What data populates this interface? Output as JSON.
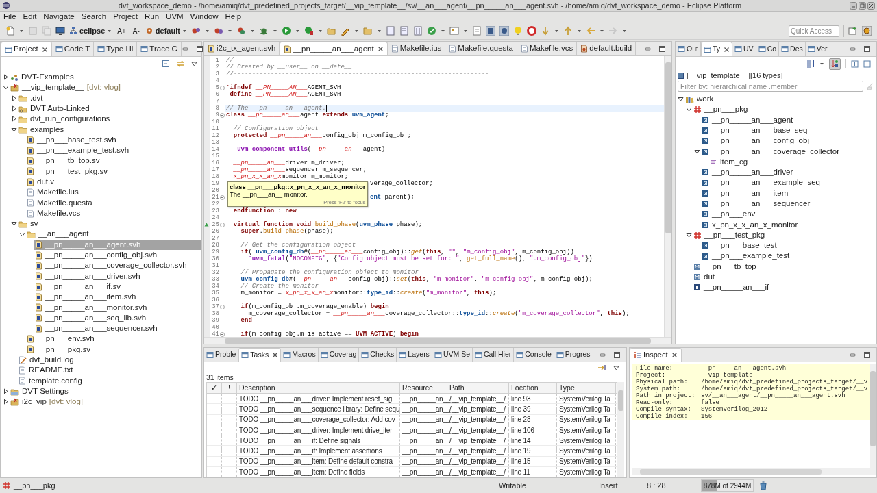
{
  "window": {
    "title": "dvt_workspace_demo - /home/amiq/dvt_predefined_projects_target/__vip_template__/sv/__an___agent/__pn_____an___agent.svh - /home/amiq/dvt_workspace_demo - Eclipse Platform"
  },
  "menu": [
    "File",
    "Edit",
    "Navigate",
    "Search",
    "Project",
    "Run",
    "UVM",
    "Window",
    "Help"
  ],
  "toolbar": {
    "perspective": "eclipse",
    "font_increase": "A+",
    "font_decrease": "A-",
    "build_config": "default",
    "quick_access_placeholder": "Quick Access"
  },
  "project_view": {
    "tabs": [
      {
        "label": "Project",
        "selected": true
      },
      {
        "label": "Code T",
        "selected": false
      },
      {
        "label": "Type Hi",
        "selected": false
      },
      {
        "label": "Trace C",
        "selected": false
      }
    ],
    "tree": [
      {
        "label": "DVT-Examples",
        "kind": "examples",
        "expanded": false,
        "selected": false
      },
      {
        "label": "__vip_template__",
        "tag": "[dvt: vlog]",
        "kind": "project",
        "expanded": true,
        "selected": false,
        "children": [
          {
            "label": ".dvt",
            "kind": "folder",
            "expanded": false,
            "selected": false
          },
          {
            "label": "DVT Auto-Linked",
            "kind": "linked-folder",
            "expanded": false,
            "selected": false
          },
          {
            "label": "dvt_run_configurations",
            "kind": "folder",
            "expanded": false,
            "selected": false
          },
          {
            "label": "examples",
            "kind": "folder",
            "expanded": true,
            "selected": false,
            "children": [
              {
                "label": "__pn___base_test.svh",
                "kind": "sv-file",
                "selected": false
              },
              {
                "label": "__pn___example_test.svh",
                "kind": "sv-file",
                "selected": false
              },
              {
                "label": "__pn___tb_top.sv",
                "kind": "sv-file",
                "selected": false
              },
              {
                "label": "__pn___test_pkg.sv",
                "kind": "sv-file",
                "selected": false
              },
              {
                "label": "dut.v",
                "kind": "sv-file",
                "selected": false
              },
              {
                "label": "Makefile.ius",
                "kind": "text-file",
                "selected": false
              },
              {
                "label": "Makefile.questa",
                "kind": "text-file",
                "selected": false
              },
              {
                "label": "Makefile.vcs",
                "kind": "text-file",
                "selected": false
              }
            ]
          },
          {
            "label": "sv",
            "kind": "folder",
            "expanded": true,
            "selected": false,
            "children": [
              {
                "label": "__an___agent",
                "kind": "folder",
                "expanded": true,
                "selected": false,
                "children": [
                  {
                    "label": "__pn_____an___agent.svh",
                    "kind": "sv-file",
                    "selected": true
                  },
                  {
                    "label": "__pn_____an___config_obj.svh",
                    "kind": "sv-file",
                    "selected": false
                  },
                  {
                    "label": "__pn_____an___coverage_collector.svh",
                    "kind": "sv-file",
                    "selected": false
                  },
                  {
                    "label": "__pn_____an___driver.svh",
                    "kind": "sv-file",
                    "selected": false
                  },
                  {
                    "label": "__pn_____an___if.sv",
                    "kind": "sv-file",
                    "selected": false
                  },
                  {
                    "label": "__pn_____an___item.svh",
                    "kind": "sv-file",
                    "selected": false
                  },
                  {
                    "label": "__pn_____an___monitor.svh",
                    "kind": "sv-file",
                    "selected": false
                  },
                  {
                    "label": "__pn_____an___seq_lib.svh",
                    "kind": "sv-file",
                    "selected": false
                  },
                  {
                    "label": "__pn_____an___sequencer.svh",
                    "kind": "sv-file",
                    "selected": false
                  }
                ]
              },
              {
                "label": "__pn___env.svh",
                "kind": "sv-file",
                "selected": false
              },
              {
                "label": "__pn___pkg.sv",
                "kind": "sv-file",
                "selected": false
              }
            ]
          },
          {
            "label": "dvt_build.log",
            "kind": "log-file",
            "selected": false
          },
          {
            "label": "README.txt",
            "kind": "text-file",
            "selected": false
          },
          {
            "label": "template.config",
            "kind": "text-file",
            "selected": false
          }
        ]
      },
      {
        "label": "DVT-Settings",
        "kind": "settings-project",
        "expanded": false,
        "selected": false
      },
      {
        "label": "i2c_vip",
        "tag": "[dvt: vlog]",
        "kind": "project",
        "expanded": false,
        "selected": false
      }
    ]
  },
  "editor": {
    "tabs": [
      {
        "label": "i2c_tx_agent.svh",
        "kind": "sv-file",
        "selected": false
      },
      {
        "label": "__pn_____an___agent",
        "kind": "sv-file",
        "selected": true
      },
      {
        "label": "Makefile.ius",
        "kind": "text-file",
        "selected": false
      },
      {
        "label": "Makefile.questa",
        "kind": "text-file",
        "selected": false
      },
      {
        "label": "Makefile.vcs",
        "kind": "text-file",
        "selected": false
      },
      {
        "label": "default.build",
        "kind": "build-file",
        "selected": false
      }
    ],
    "lines": [
      {
        "number": "1",
        "current": false,
        "segments": [
          {
            "kind": "c",
            "text": "//---------------------------------------------------------------------"
          }
        ]
      },
      {
        "number": "2",
        "current": false,
        "segments": [
          {
            "kind": "c",
            "text": "// Created by __user__ on __date__"
          }
        ]
      },
      {
        "number": "3",
        "current": false,
        "segments": [
          {
            "kind": "c",
            "text": "//---------------------------------------------------------------------"
          }
        ]
      },
      {
        "number": "4",
        "current": false
      },
      {
        "number": "5",
        "current": false,
        "fold": true,
        "segments": [
          {
            "kind": "k",
            "text": "`ifndef "
          },
          {
            "kind": "p",
            "text": "__PN_____AN___"
          },
          {
            "kind": "x",
            "text": "AGENT_SVH"
          }
        ]
      },
      {
        "number": "6",
        "current": false,
        "segments": [
          {
            "kind": "k",
            "text": "`define "
          },
          {
            "kind": "p",
            "text": "__PN_____AN___"
          },
          {
            "kind": "x",
            "text": "AGENT_SVH"
          }
        ]
      },
      {
        "number": "7",
        "current": false
      },
      {
        "number": "8",
        "current": true,
        "segments": [
          {
            "kind": "c",
            "text": "// The __pn__ __an__ agent."
          }
        ]
      },
      {
        "number": "9",
        "current": false,
        "fold": true,
        "segments": [
          {
            "kind": "k",
            "text": "class "
          },
          {
            "kind": "p",
            "text": "__pn_____an___"
          },
          {
            "kind": "x",
            "text": "agent "
          },
          {
            "kind": "k",
            "text": "extends "
          },
          {
            "kind": "t",
            "text": "uvm_agent"
          },
          {
            "kind": "x",
            "text": ";"
          }
        ]
      },
      {
        "number": "10",
        "current": false
      },
      {
        "number": "11",
        "current": false,
        "segments": [
          {
            "kind": "c",
            "text": "  // Configuration object"
          }
        ]
      },
      {
        "number": "12",
        "current": false,
        "segments": [
          {
            "kind": "k",
            "text": "  protected "
          },
          {
            "kind": "p",
            "text": "__pn_____an___"
          },
          {
            "kind": "x",
            "text": "config_obj m_config_obj;"
          }
        ]
      },
      {
        "number": "13",
        "current": false
      },
      {
        "number": "14",
        "current": false,
        "segments": [
          {
            "kind": "m",
            "text": "  `uvm_component_utils"
          },
          {
            "kind": "x",
            "text": "("
          },
          {
            "kind": "p",
            "text": "__pn_____an___"
          },
          {
            "kind": "x",
            "text": "agent)"
          }
        ]
      },
      {
        "number": "15",
        "current": false
      },
      {
        "number": "16",
        "current": false,
        "segments": [
          {
            "kind": "p",
            "text": "  __pn_____an___"
          },
          {
            "kind": "x",
            "text": "driver m_driver;"
          }
        ]
      },
      {
        "number": "17",
        "current": false,
        "segments": [
          {
            "kind": "p",
            "text": "  __pn_____an___"
          },
          {
            "kind": "x",
            "text": "sequencer m_sequencer;"
          }
        ]
      },
      {
        "number": "18",
        "current": false,
        "segments": [
          {
            "kind": "p",
            "text": "  x_pn_x_x_an_x"
          },
          {
            "kind": "x",
            "text": "monitor m_monitor;"
          }
        ]
      },
      {
        "number": "19",
        "current": false,
        "covered": true,
        "segments": [
          {
            "kind": "x",
            "text": "verage_collector;"
          }
        ]
      },
      {
        "number": "20",
        "current": false
      },
      {
        "number": "21",
        "current": false,
        "fold": true,
        "covered": true,
        "segments": [
          {
            "kind": "t",
            "text": "ent"
          },
          {
            "kind": "x",
            "text": " parent);"
          }
        ]
      },
      {
        "number": "22",
        "current": false
      },
      {
        "number": "23",
        "current": false,
        "segments": [
          {
            "kind": "k",
            "text": "  endfunction"
          },
          {
            "kind": "x",
            "text": " : "
          },
          {
            "kind": "k",
            "text": "new"
          }
        ]
      },
      {
        "number": "24",
        "current": false
      },
      {
        "number": "25",
        "current": false,
        "fold": true,
        "override": true,
        "segments": [
          {
            "kind": "k",
            "text": "  virtual function void "
          },
          {
            "kind": "f",
            "text": "build_phase"
          },
          {
            "kind": "x",
            "text": "("
          },
          {
            "kind": "t",
            "text": "uvm_phase"
          },
          {
            "kind": "x",
            "text": " phase);"
          }
        ]
      },
      {
        "number": "26",
        "current": false,
        "segments": [
          {
            "kind": "k",
            "text": "    super"
          },
          {
            "kind": "x",
            "text": "."
          },
          {
            "kind": "f",
            "text": "build_phase"
          },
          {
            "kind": "x",
            "text": "(phase);"
          }
        ]
      },
      {
        "number": "27",
        "current": false
      },
      {
        "number": "28",
        "current": false,
        "segments": [
          {
            "kind": "c",
            "text": "    // Get the configuration object"
          }
        ]
      },
      {
        "number": "29",
        "current": false,
        "segments": [
          {
            "kind": "k",
            "text": "    if"
          },
          {
            "kind": "x",
            "text": "(!"
          },
          {
            "kind": "t",
            "text": "uvm_config_db"
          },
          {
            "kind": "x",
            "text": "#("
          },
          {
            "kind": "p",
            "text": "__pn_____an___"
          },
          {
            "kind": "x",
            "text": "config_obj)::"
          },
          {
            "kind": "fi",
            "text": "get"
          },
          {
            "kind": "x",
            "text": "("
          },
          {
            "kind": "k",
            "text": "this"
          },
          {
            "kind": "x",
            "text": ", "
          },
          {
            "kind": "s",
            "text": "\"\""
          },
          {
            "kind": "x",
            "text": ", "
          },
          {
            "kind": "s",
            "text": "\"m_config_obj\""
          },
          {
            "kind": "x",
            "text": ", m_config_obj))"
          }
        ]
      },
      {
        "number": "30",
        "current": false,
        "segments": [
          {
            "kind": "m",
            "text": "      `uvm_fatal"
          },
          {
            "kind": "x",
            "text": "("
          },
          {
            "kind": "s",
            "text": "\"NOCONFIG\""
          },
          {
            "kind": "x",
            "text": ", {"
          },
          {
            "kind": "s",
            "text": "\"Config object must be set for: \""
          },
          {
            "kind": "x",
            "text": ", "
          },
          {
            "kind": "f",
            "text": "get_full_name"
          },
          {
            "kind": "x",
            "text": "(), "
          },
          {
            "kind": "s",
            "text": "\".m_config_obj\""
          },
          {
            "kind": "x",
            "text": "})"
          }
        ]
      },
      {
        "number": "31",
        "current": false
      },
      {
        "number": "32",
        "current": false,
        "segments": [
          {
            "kind": "c",
            "text": "    // Propagate the configuration object to monitor"
          }
        ]
      },
      {
        "number": "33",
        "current": false,
        "segments": [
          {
            "kind": "t",
            "text": "    uvm_config_db"
          },
          {
            "kind": "x",
            "text": "#("
          },
          {
            "kind": "p",
            "text": "__pn_____an___"
          },
          {
            "kind": "x",
            "text": "config_obj)::"
          },
          {
            "kind": "fi",
            "text": "set"
          },
          {
            "kind": "x",
            "text": "("
          },
          {
            "kind": "k",
            "text": "this"
          },
          {
            "kind": "x",
            "text": ", "
          },
          {
            "kind": "s",
            "text": "\"m_monitor\""
          },
          {
            "kind": "x",
            "text": ", "
          },
          {
            "kind": "s",
            "text": "\"m_config_obj\""
          },
          {
            "kind": "x",
            "text": ", m_config_obj);"
          }
        ]
      },
      {
        "number": "34",
        "current": false,
        "segments": [
          {
            "kind": "c",
            "text": "    // Create the monitor"
          }
        ]
      },
      {
        "number": "35",
        "current": false,
        "segments": [
          {
            "kind": "x",
            "text": "    m_monitor = "
          },
          {
            "kind": "p",
            "text": "x_pn_x_x_an_x"
          },
          {
            "kind": "x",
            "text": "monitor::"
          },
          {
            "kind": "t",
            "text": "type_id"
          },
          {
            "kind": "x",
            "text": "::"
          },
          {
            "kind": "fi",
            "text": "create"
          },
          {
            "kind": "x",
            "text": "("
          },
          {
            "kind": "s",
            "text": "\"m_monitor\""
          },
          {
            "kind": "x",
            "text": ", "
          },
          {
            "kind": "k",
            "text": "this"
          },
          {
            "kind": "x",
            "text": ");"
          }
        ]
      },
      {
        "number": "36",
        "current": false
      },
      {
        "number": "37",
        "current": false,
        "fold": true,
        "segments": [
          {
            "kind": "k",
            "text": "    if"
          },
          {
            "kind": "x",
            "text": "(m_config_obj.m_coverage_enable) "
          },
          {
            "kind": "k",
            "text": "begin"
          }
        ]
      },
      {
        "number": "38",
        "current": false,
        "segments": [
          {
            "kind": "x",
            "text": "      m_coverage_collector = "
          },
          {
            "kind": "p",
            "text": "__pn_____an___"
          },
          {
            "kind": "x",
            "text": "coverage_collector::"
          },
          {
            "kind": "t",
            "text": "type_id"
          },
          {
            "kind": "x",
            "text": "::"
          },
          {
            "kind": "fi",
            "text": "create"
          },
          {
            "kind": "x",
            "text": "("
          },
          {
            "kind": "s",
            "text": "\"m_coverage_collector\""
          },
          {
            "kind": "x",
            "text": ", "
          },
          {
            "kind": "k",
            "text": "this"
          },
          {
            "kind": "x",
            "text": ");"
          }
        ]
      },
      {
        "number": "39",
        "current": false,
        "segments": [
          {
            "kind": "k",
            "text": "    end"
          }
        ]
      },
      {
        "number": "40",
        "current": false
      },
      {
        "number": "41",
        "current": false,
        "fold": true,
        "segments": [
          {
            "kind": "k",
            "text": "    if"
          },
          {
            "kind": "x",
            "text": "(m_config_obj.m_is_active == "
          },
          {
            "kind": "k",
            "text": "UVM_ACTIVE"
          },
          {
            "kind": "x",
            "text": ") "
          },
          {
            "kind": "k",
            "text": "begin"
          }
        ]
      }
    ],
    "tooltip": {
      "title": "class __pn___pkg::x_pn_x_x_an_x_monitor",
      "text": "The __pn___an__ monitor.",
      "hint": "Press 'F2' to focus"
    }
  },
  "types_view": {
    "tabs": [
      {
        "label": "Out",
        "selected": false
      },
      {
        "label": "Ty",
        "selected": true
      },
      {
        "label": "UV",
        "selected": false
      },
      {
        "label": "Co",
        "selected": false
      },
      {
        "label": "Des",
        "selected": false
      },
      {
        "label": "Ver",
        "selected": false
      }
    ],
    "header": "[__vip_template__][16 types]",
    "filter_placeholder": "Filter by: hierarchical name .member",
    "tree": [
      {
        "label": "work",
        "kind": "library",
        "expanded": true,
        "children": [
          {
            "label": "__pn___pkg",
            "kind": "package",
            "expanded": true,
            "children": [
              {
                "label": "__pn_____an___agent",
                "kind": "class"
              },
              {
                "label": "__pn_____an___base_seq",
                "kind": "class"
              },
              {
                "label": "__pn_____an___config_obj",
                "kind": "class"
              },
              {
                "label": "__pn_____an___coverage_collector",
                "kind": "class",
                "expanded": true,
                "children": [
                  {
                    "label": "item_cg",
                    "kind": "covergroup"
                  }
                ]
              },
              {
                "label": "__pn_____an___driver",
                "kind": "class"
              },
              {
                "label": "__pn_____an___example_seq",
                "kind": "class"
              },
              {
                "label": "__pn_____an___item",
                "kind": "class"
              },
              {
                "label": "__pn_____an___sequencer",
                "kind": "class"
              },
              {
                "label": "__pn___env",
                "kind": "class"
              },
              {
                "label": "x_pn_x_x_an_x_monitor",
                "kind": "class"
              }
            ]
          },
          {
            "label": "__pn___test_pkg",
            "kind": "package",
            "expanded": true,
            "children": [
              {
                "label": "__pn___base_test",
                "kind": "class"
              },
              {
                "label": "__pn___example_test",
                "kind": "class"
              }
            ]
          },
          {
            "label": "__pn___tb_top",
            "kind": "module"
          },
          {
            "label": "dut",
            "kind": "module"
          },
          {
            "label": "__pn_____an___if",
            "kind": "interface"
          }
        ]
      }
    ]
  },
  "tasks_view": {
    "tabs": [
      {
        "label": "Proble",
        "selected": false
      },
      {
        "label": "Tasks",
        "selected": true
      },
      {
        "label": "Macros",
        "selected": false
      },
      {
        "label": "Coverag",
        "selected": false
      },
      {
        "label": "Checks",
        "selected": false
      },
      {
        "label": "Layers",
        "selected": false
      },
      {
        "label": "UVM Se",
        "selected": false
      },
      {
        "label": "Call Hier",
        "selected": false
      },
      {
        "label": "Console",
        "selected": false
      },
      {
        "label": "Progres",
        "selected": false
      }
    ],
    "count": "31 items",
    "columns": [
      "✓",
      "!",
      "Description",
      "Resource",
      "Path",
      "Location",
      "Type"
    ],
    "rows": [
      {
        "description": "TODO __pn_____an___driver: Implement reset_sig",
        "resource": "__pn_____an__",
        "path": "/__vip_template__/",
        "location": "line 93",
        "type": "SystemVerilog Ta"
      },
      {
        "description": "TODO __pn_____an___sequence library: Define sequ",
        "resource": "__pn_____an__",
        "path": "/__vip_template__/",
        "location": "line 39",
        "type": "SystemVerilog Ta"
      },
      {
        "description": "TODO __pn_____an___coverage_collector: Add cov",
        "resource": "__pn_____an__",
        "path": "/__vip_template__/",
        "location": "line 28",
        "type": "SystemVerilog Ta"
      },
      {
        "description": "TODO __pn_____an___driver: Implement drive_iter",
        "resource": "__pn_____an__",
        "path": "/__vip_template__/",
        "location": "line 106",
        "type": "SystemVerilog Ta"
      },
      {
        "description": "TODO __pn_____an___if: Define signals",
        "resource": "__pn_____an__",
        "path": "/__vip_template__/",
        "location": "line 14",
        "type": "SystemVerilog Ta"
      },
      {
        "description": "TODO __pn_____an___if: Implement assertions",
        "resource": "__pn_____an__",
        "path": "/__vip_template__/",
        "location": "line 19",
        "type": "SystemVerilog Ta"
      },
      {
        "description": "TODO __pn_____an___item: Define default constra",
        "resource": "__pn_____an__",
        "path": "/__vip_template__/",
        "location": "line 15",
        "type": "SystemVerilog Ta"
      },
      {
        "description": "TODO __pn_____an___item: Define fields",
        "resource": "__pn_____an__",
        "path": "/__vip_template__/",
        "location": "line 11",
        "type": "SystemVerilog Ta"
      }
    ]
  },
  "inspect_view": {
    "tab": {
      "label": "Inspect",
      "selected": true
    },
    "rows": [
      {
        "label": "File name:",
        "value": "__pn_____an___agent.svh"
      },
      {
        "label": "Project:",
        "value": "__vip_template__"
      },
      {
        "label": "Physical path:",
        "value": "/home/amiq/dvt_predefined_projects_target/__v"
      },
      {
        "label": "System path:",
        "value": "/home/amiq/dvt_predefined_projects_target/__v"
      },
      {
        "label": "Path in project:",
        "value": "sv/__an___agent/__pn_____an___agent.svh"
      },
      {
        "label": "Read-only:",
        "value": "false"
      },
      {
        "label": "Compile syntax:",
        "value": "SystemVerilog_2012"
      },
      {
        "label": "Compile index:",
        "value": "156"
      }
    ]
  },
  "status_bar": {
    "element": "__pn___pkg",
    "mode": "Writable",
    "insert": "Insert",
    "position": "8 : 28",
    "memory": {
      "reading": "878M of 2944M",
      "level": 0.3
    }
  }
}
